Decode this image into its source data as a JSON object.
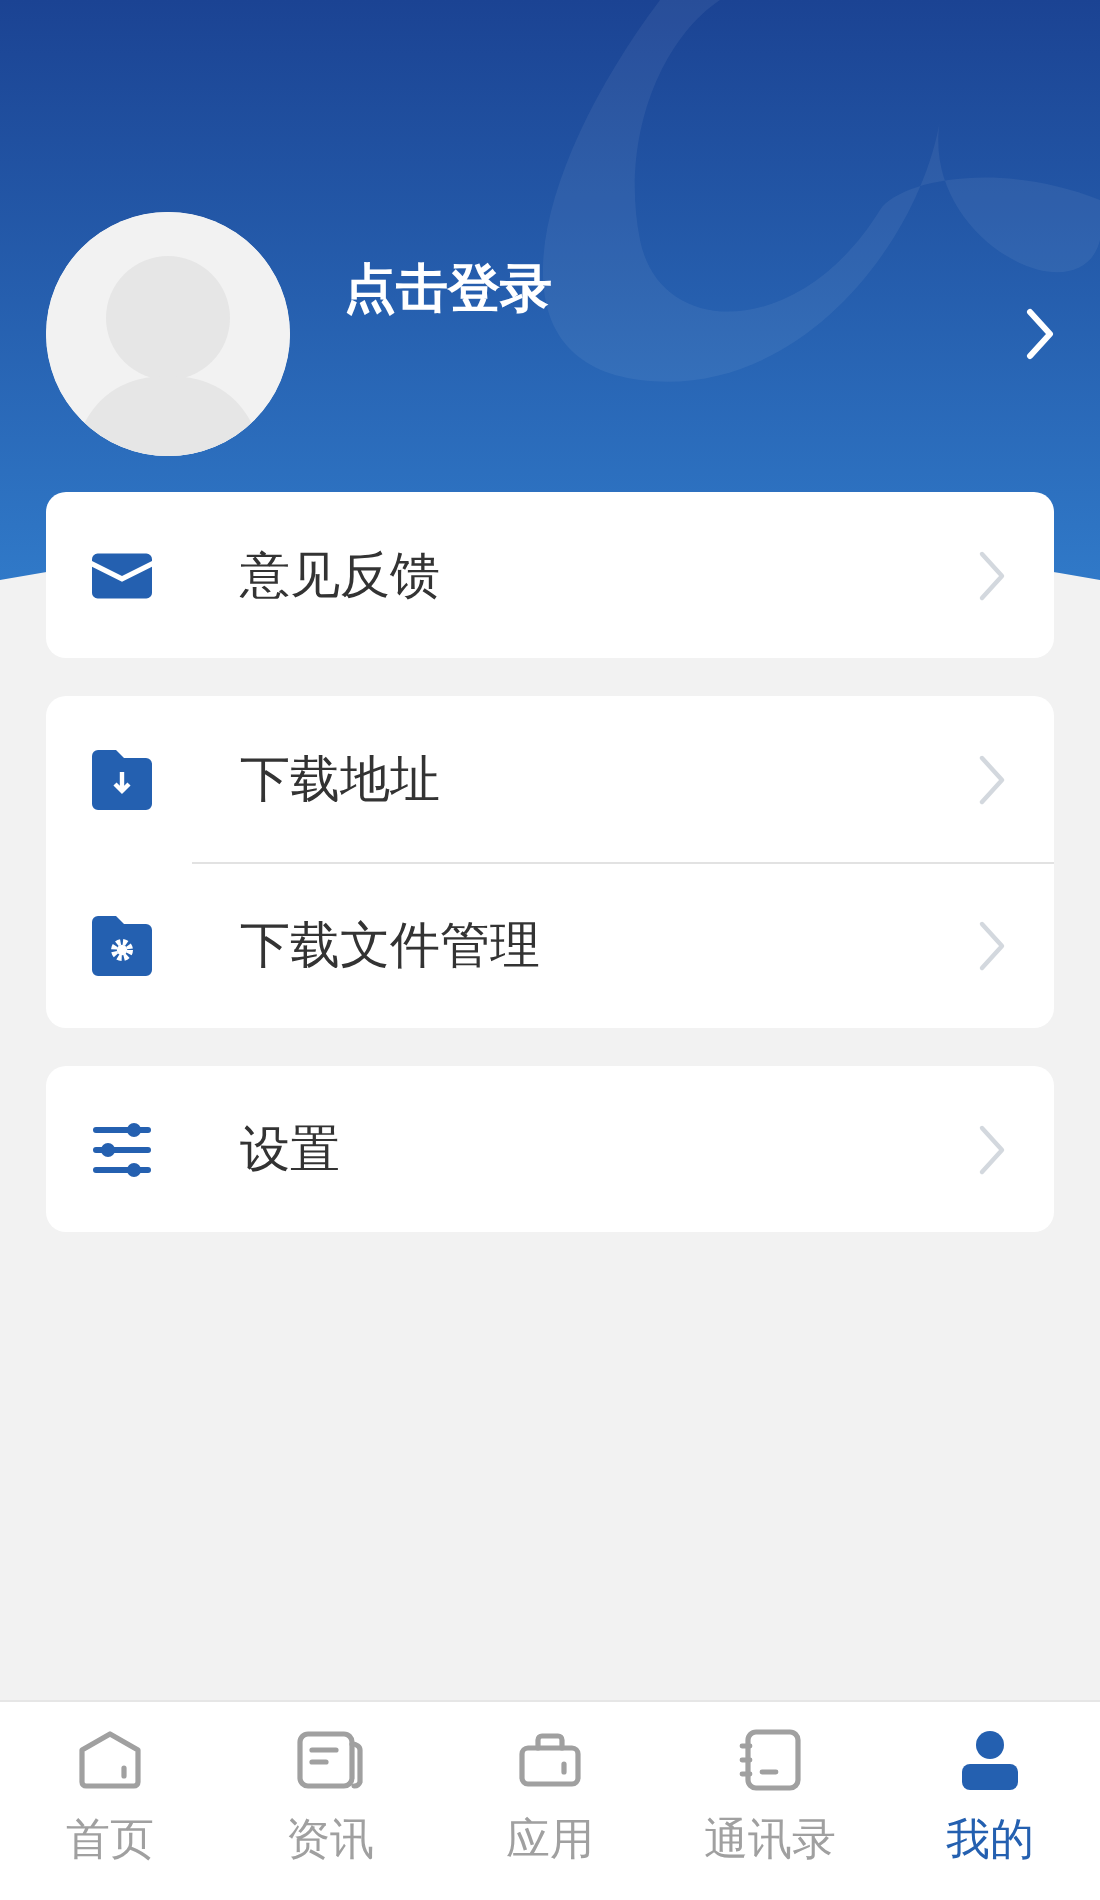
{
  "profile": {
    "login_label": "点击登录"
  },
  "menu_groups": [
    [
      {
        "kind": "mail",
        "label": "意见反馈"
      }
    ],
    [
      {
        "kind": "download-folder",
        "label": "下载地址"
      },
      {
        "kind": "gear-folder",
        "label": "下载文件管理"
      }
    ],
    [
      {
        "kind": "sliders",
        "label": "设置"
      }
    ]
  ],
  "tab_bar": [
    {
      "kind": "home",
      "label": "首页",
      "selected": false
    },
    {
      "kind": "news",
      "label": "资讯",
      "selected": false
    },
    {
      "kind": "apps",
      "label": "应用",
      "selected": false
    },
    {
      "kind": "contacts",
      "label": "通讯录",
      "selected": false
    },
    {
      "kind": "me",
      "label": "我的",
      "selected": true
    }
  ]
}
